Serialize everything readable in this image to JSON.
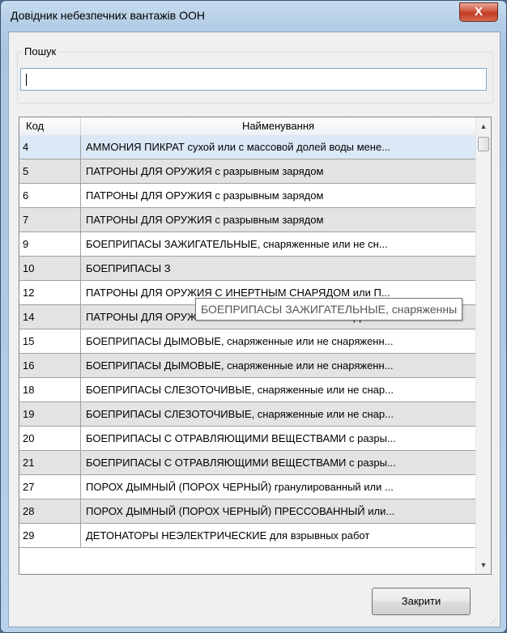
{
  "window": {
    "title": "Довідник небезпечних вантажів ООН",
    "close_glyph": "X"
  },
  "search": {
    "group_label": "Пошук",
    "value": ""
  },
  "table": {
    "headers": {
      "code": "Код",
      "name": "Найменування"
    },
    "rows": [
      {
        "code": "4",
        "name": "АММОНИЯ ПИКРАТ сухой или с массовой долей воды мене..."
      },
      {
        "code": "5",
        "name": "ПАТРОНЫ ДЛЯ ОРУЖИЯ с разрывным зарядом"
      },
      {
        "code": "6",
        "name": "ПАТРОНЫ ДЛЯ ОРУЖИЯ с разрывным зарядом"
      },
      {
        "code": "7",
        "name": "ПАТРОНЫ ДЛЯ ОРУЖИЯ с разрывным зарядом"
      },
      {
        "code": "9",
        "name": "БОЕПРИПАСЫ ЗАЖИГАТЕЛЬНЫЕ, снаряженные или не сн..."
      },
      {
        "code": "10",
        "name": "БОЕПРИПАСЫ З"
      },
      {
        "code": "12",
        "name": "ПАТРОНЫ ДЛЯ ОРУЖИЯ С ИНЕРТНЫМ СНАРЯДОМ или П..."
      },
      {
        "code": "14",
        "name": "ПАТРОНЫ ДЛЯ ОРУЖИЯ ХОЛОСТЫЕ или ПАТРОНЫ ДЛЯ ..."
      },
      {
        "code": "15",
        "name": "БОЕПРИПАСЫ ДЫМОВЫЕ, снаряженные или не снаряженн..."
      },
      {
        "code": "16",
        "name": "БОЕПРИПАСЫ ДЫМОВЫЕ, снаряженные или не снаряженн..."
      },
      {
        "code": "18",
        "name": "БОЕПРИПАСЫ СЛЕЗОТОЧИВЫЕ, снаряженные или не снар..."
      },
      {
        "code": "19",
        "name": "БОЕПРИПАСЫ СЛЕЗОТОЧИВЫЕ, снаряженные или не снар..."
      },
      {
        "code": "20",
        "name": "БОЕПРИПАСЫ С ОТРАВЛЯЮЩИМИ ВЕЩЕСТВАМИ с разры..."
      },
      {
        "code": "21",
        "name": "БОЕПРИПАСЫ С ОТРАВЛЯЮЩИМИ ВЕЩЕСТВАМИ с разры..."
      },
      {
        "code": "27",
        "name": "ПОРОХ ДЫМНЫЙ (ПОРОХ ЧЕРНЫЙ) гранулированный или ..."
      },
      {
        "code": "28",
        "name": "ПОРОХ ДЫМНЫЙ (ПОРОХ ЧЕРНЫЙ) ПРЕССОВАННЫЙ или..."
      },
      {
        "code": "29",
        "name": "ДЕТОНАТОРЫ НЕЭЛЕКТРИЧЕСКИЕ для взрывных работ"
      }
    ],
    "tooltip": "БОЕПРИПАСЫ ЗАЖИГАТЕЛЬНЫЕ, снаряженны",
    "scroll_up_glyph": "▲",
    "scroll_down_glyph": "▼"
  },
  "footer": {
    "close_label": "Закрити",
    "grip_glyph": "⋰"
  },
  "icons": {
    "close": "close-icon",
    "scroll_up": "scroll-up-arrow-icon",
    "scroll_down": "scroll-down-arrow-icon",
    "resize": "resize-grip-icon"
  },
  "colors": {
    "row_alt": "#e3e3e3",
    "row_selected": "#dbe8f6",
    "close_red": "#c13a22",
    "frame": "#a9c5e0"
  }
}
